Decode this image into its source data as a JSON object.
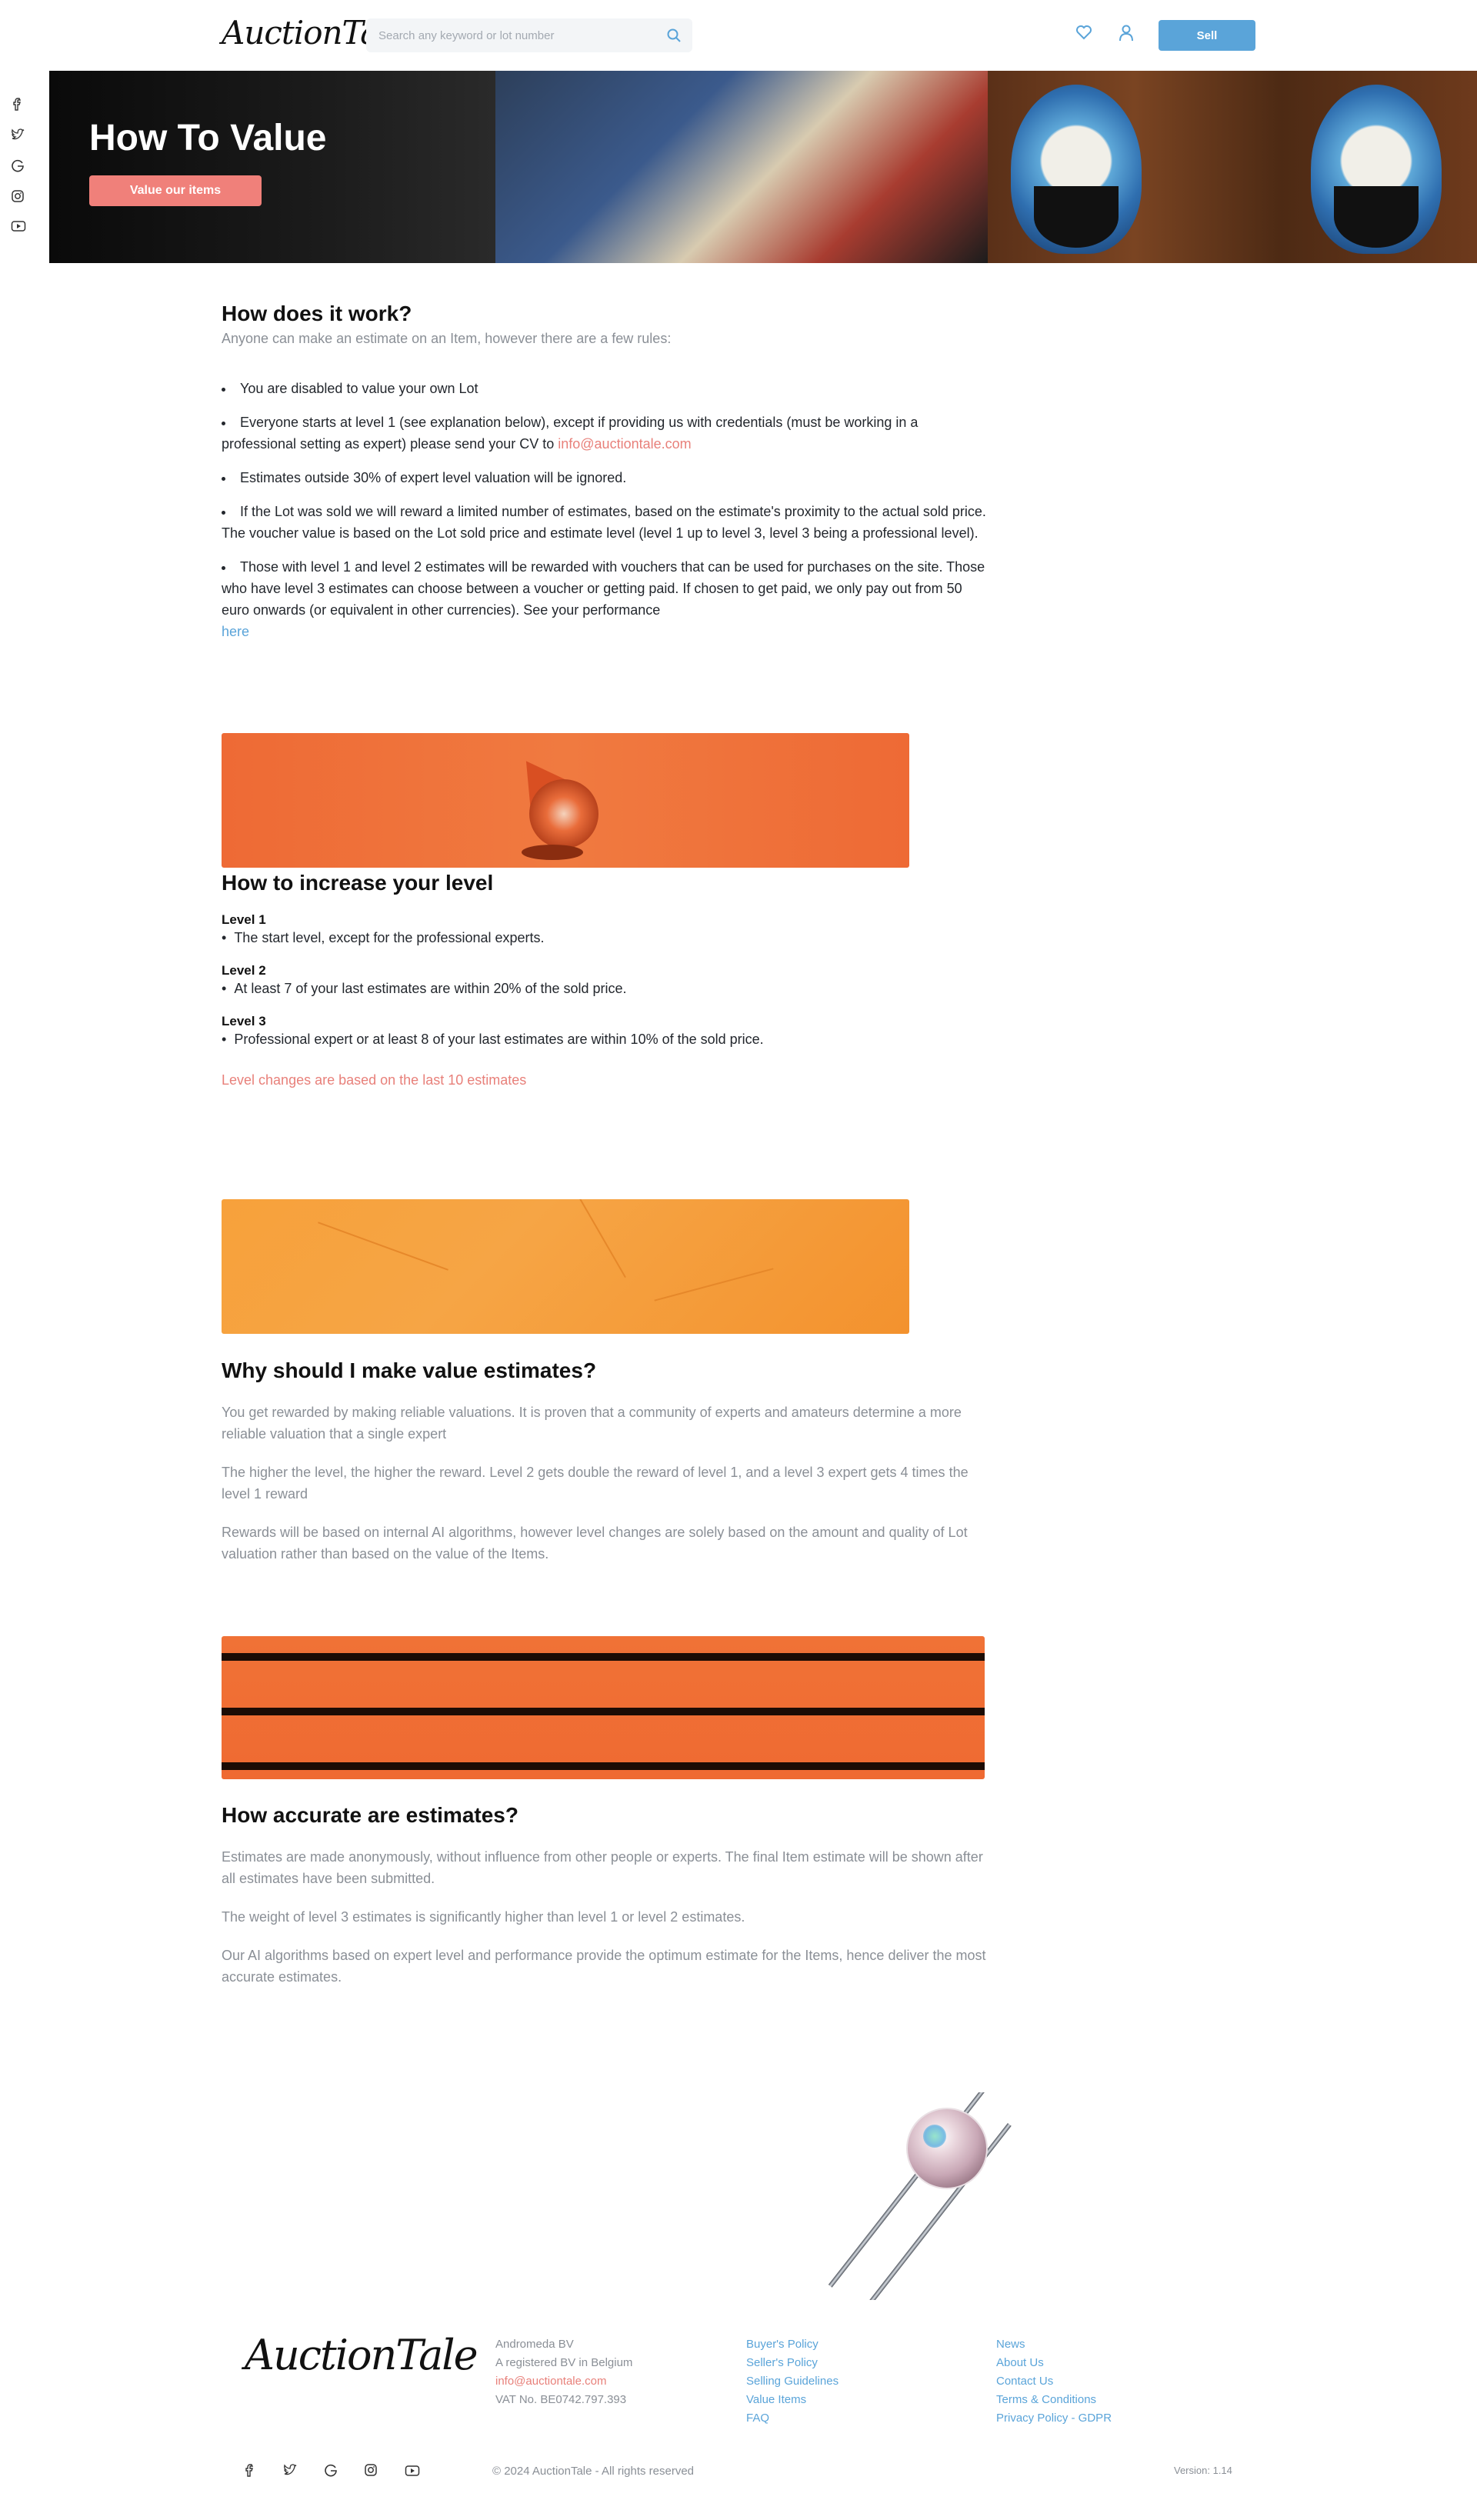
{
  "header": {
    "logo_text": "AuctionTale",
    "search_placeholder": "Search any keyword or lot number",
    "sell_label": "Sell",
    "icons": [
      "heart-icon",
      "user-icon",
      "search-icon"
    ]
  },
  "side_social": [
    "facebook-icon",
    "twitter-icon",
    "google-icon",
    "instagram-icon",
    "youtube-icon"
  ],
  "hero": {
    "title": "How To Value",
    "cta_label": "Value our items"
  },
  "section_how": {
    "title": "How does it work?",
    "lead": "Anyone can make an estimate on an Item, however there are a few rules:",
    "rules": [
      {
        "text": "You are disabled to value your own Lot"
      },
      {
        "text": "Everyone starts at level 1 (see explanation below), except if providing us with credentials (must be working in a professional setting as expert) please send your CV to ",
        "link": "info@auctiontale.com"
      },
      {
        "text": "Estimates outside 30% of expert level valuation will be ignored."
      },
      {
        "text": "If the Lot was sold we will reward a limited number of estimates, based on the estimate's proximity to the actual sold price. The voucher value is based on the Lot sold price and estimate level (level 1 up to level 3, level 3 being a professional level)."
      },
      {
        "text": "Those with level 1 and level 2 estimates will be rewarded with vouchers that can be used for purchases on the site. Those who have level 3 estimates can choose between a voucher or getting paid. If chosen to get paid, we only pay out from 50 euro onwards (or equivalent in other currencies). See your performance ",
        "link": "here"
      }
    ]
  },
  "section_level": {
    "title": "How to increase your level",
    "levels": [
      {
        "name": "Level 1",
        "desc": "The start level, except for the professional experts."
      },
      {
        "name": "Level 2",
        "desc": "At least 7 of your last estimates are within 20% of the sold price."
      },
      {
        "name": "Level 3",
        "desc": "Professional expert or at least 8 of your last estimates are within 10% of the sold price."
      }
    ],
    "note": "Level changes are based on the last 10 estimates"
  },
  "section_why": {
    "title": "Why should I make value estimates?",
    "paragraphs": [
      "You get rewarded by making reliable valuations. It is proven that a community of experts and amateurs determine a more reliable valuation that a single expert",
      "The higher the level, the higher the reward. Level 2 gets double the reward of level 1, and a level 3 expert gets 4 times the level 1 reward",
      "Rewards will be based on internal AI algorithms, however level changes are solely based on the amount and quality of Lot valuation rather than based on the value of the Items."
    ]
  },
  "section_accuracy": {
    "title": "How accurate are estimates?",
    "paragraphs": [
      "Estimates are made anonymously, without influence from other people or experts. The final Item estimate will be shown after all estimates have been submitted.",
      "The weight of level 3 estimates is significantly higher than level 1 or level 2 estimates.",
      "Our AI algorithms based on expert level and performance provide the optimum estimate for the Items, hence deliver the most accurate estimates."
    ]
  },
  "footer": {
    "logo_text": "AuctionTale",
    "company": [
      "Andromeda BV",
      "A registered BV in Belgium"
    ],
    "email": "info@auctiontale.com",
    "vat": "VAT No. BE0742.797.393",
    "links_col1": [
      "Buyer's Policy",
      "Seller's Policy",
      "Selling Guidelines",
      "Value Items",
      "FAQ"
    ],
    "links_col2": [
      "News",
      "About Us",
      "Contact Us",
      "Terms & Conditions",
      "Privacy Policy - GDPR"
    ],
    "copyright": "© 2024 AuctionTale - All rights reserved",
    "version": "Version: 1.14",
    "social": [
      "facebook-icon",
      "twitter-icon",
      "google-icon",
      "instagram-icon",
      "youtube-icon"
    ]
  },
  "colors": {
    "accent_blue": "#5aa4d9",
    "accent_pink": "#f0807a",
    "banner_orange": "#ef6a32"
  }
}
